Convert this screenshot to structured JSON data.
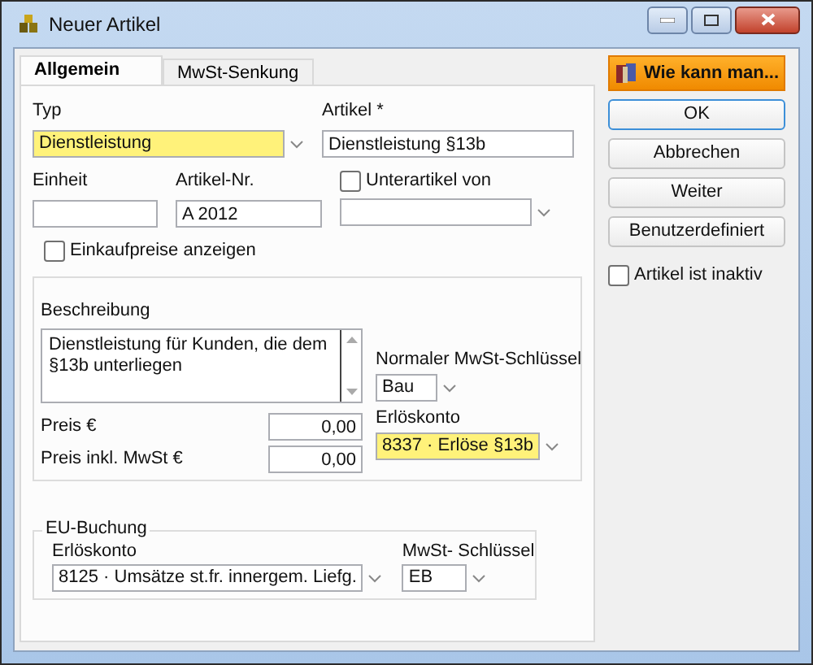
{
  "window": {
    "title": "Neuer Artikel"
  },
  "tabs": [
    {
      "label": "Allgemein",
      "selected": true
    },
    {
      "label": "MwSt-Senkung",
      "selected": false
    }
  ],
  "typ": {
    "label": "Typ",
    "value": "Dienstleistung",
    "highlighted": true
  },
  "artikel": {
    "label": "Artikel *",
    "value": "Dienstleistung §13b"
  },
  "einheit": {
    "label": "Einheit"
  },
  "artikel_nr": {
    "label": "Artikel-Nr.",
    "value": "A 2012"
  },
  "unterartikel": {
    "label": "Unterartikel von",
    "checked": false
  },
  "einkaufpreise": {
    "label": "Einkaufpreise anzeigen",
    "checked": false
  },
  "beschreibung": {
    "label": "Beschreibung",
    "value": "Dienstleistung für Kunden, die dem §13b unterliegen"
  },
  "mwst_schluessel": {
    "label": "Normaler MwSt-Schlüssel",
    "value": "Bau",
    "highlighted": false
  },
  "erloeskonto": {
    "label": "Erlöskonto",
    "value": "8337 · Erlöse §13b",
    "highlighted": true
  },
  "preis": {
    "label": "Preis €",
    "value": "0,00"
  },
  "preis_inkl": {
    "label": "Preis inkl. MwSt €",
    "value": "0,00"
  },
  "eu_buchung": {
    "title": "EU-Buchung",
    "erloeskonto": {
      "label": "Erlöskonto",
      "value": "8125 · Umsätze st.fr. innergem. Liefg.",
      "highlighted": false
    },
    "mwst": {
      "label": "MwSt- Schlüssel",
      "value": "EB",
      "highlighted": false
    }
  },
  "help_button": "Wie kann man...",
  "buttons": [
    {
      "label": "OK",
      "kind": "default"
    },
    {
      "label": "Abbrechen",
      "kind": "normal"
    },
    {
      "label": "Weiter",
      "kind": "normal"
    },
    {
      "label": "Benutzerdefiniert",
      "kind": "normal"
    }
  ],
  "inaktiv": {
    "label": "Artikel ist inaktiv",
    "checked": false
  }
}
